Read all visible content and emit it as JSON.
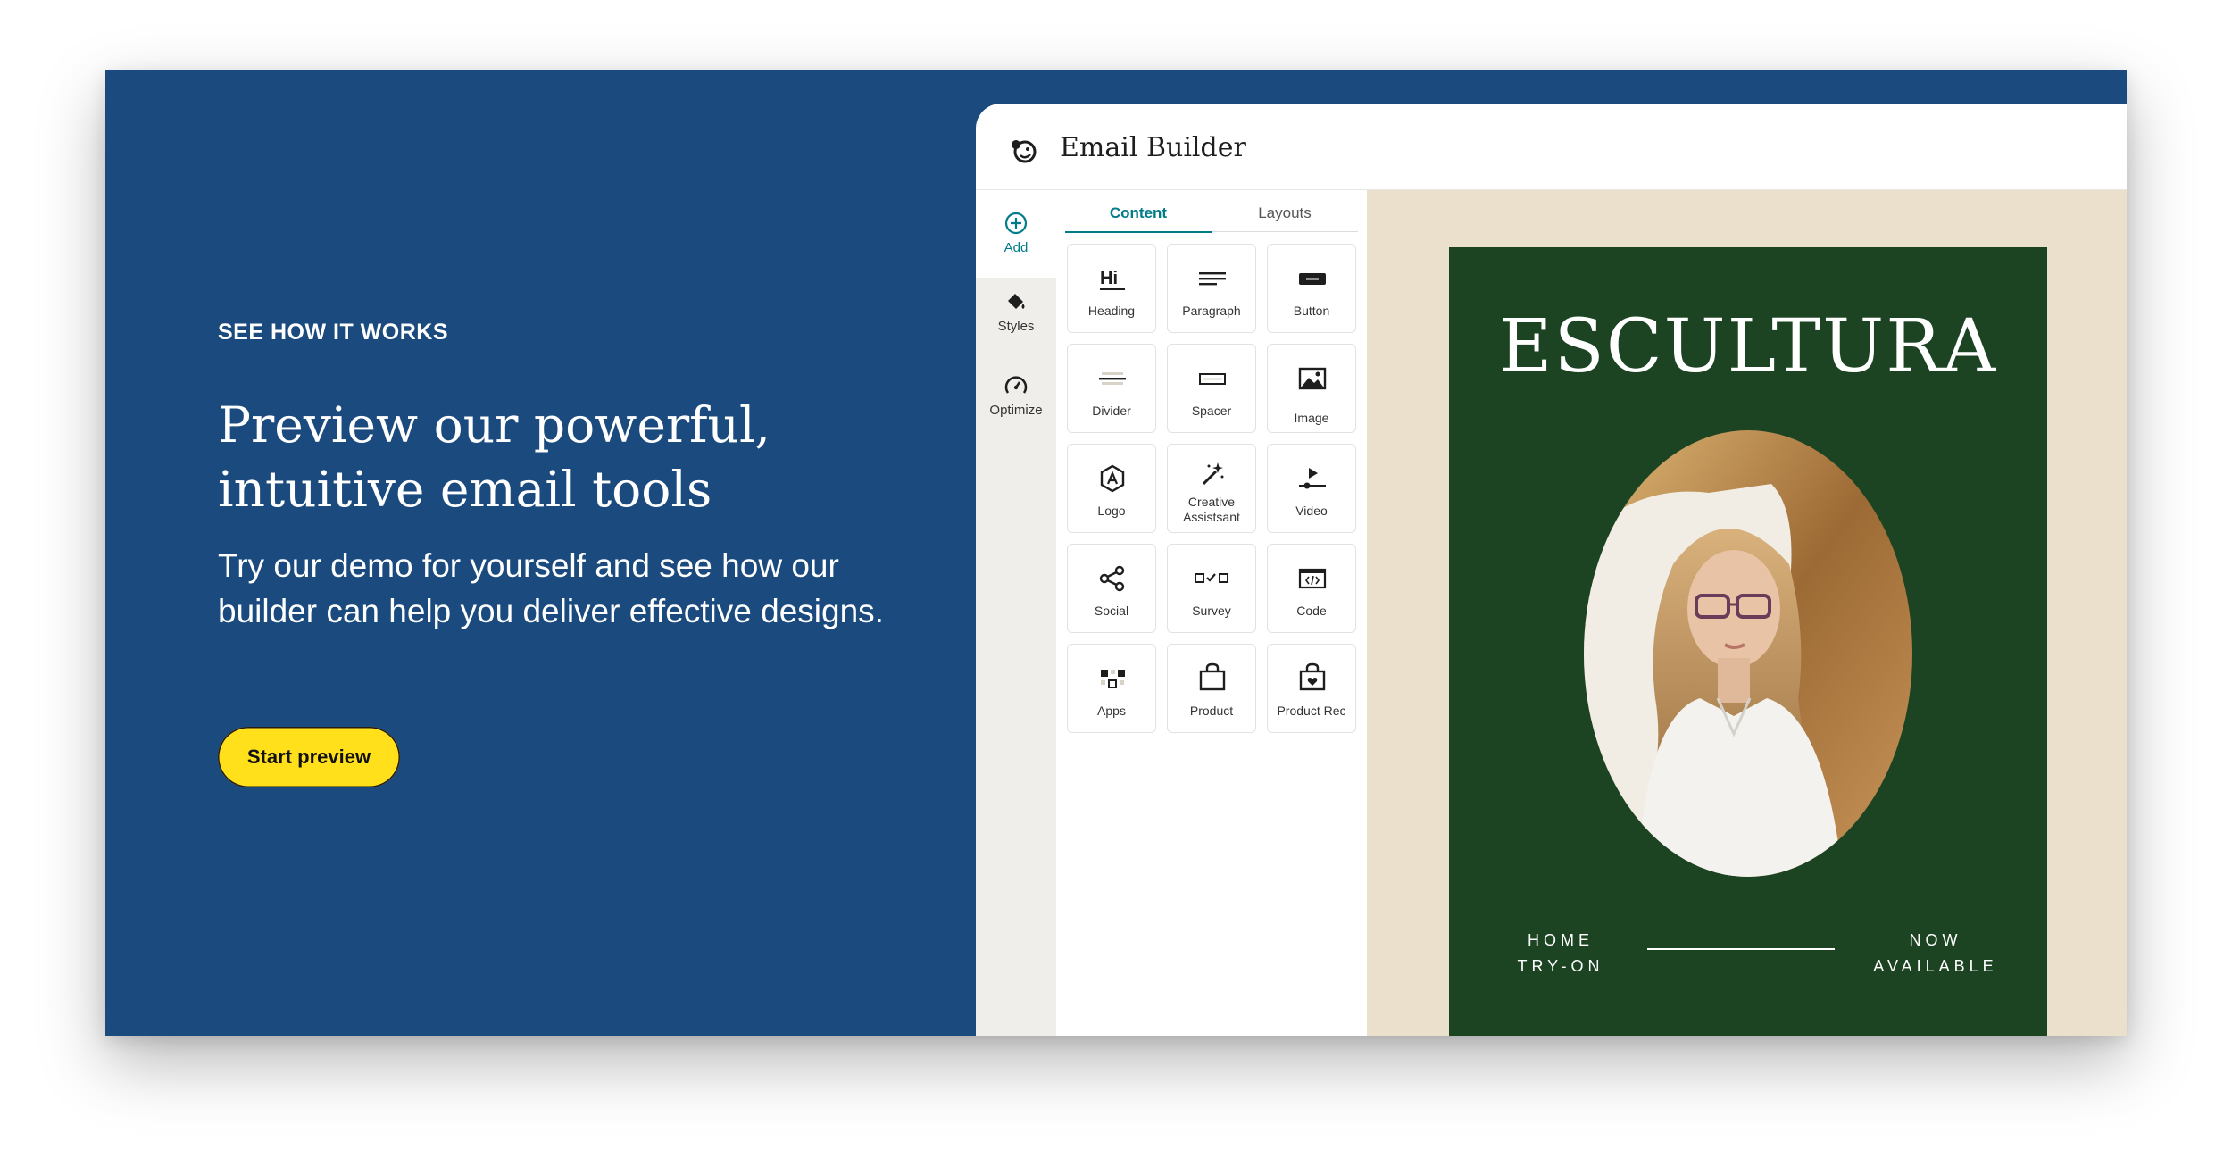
{
  "hero": {
    "eyebrow": "SEE HOW IT WORKS",
    "headline_line1": "Preview our powerful,",
    "headline_line2": "intuitive email tools",
    "subtext": "Try our demo for yourself and see how our builder can help you deliver effective designs.",
    "cta_label": "Start preview"
  },
  "builder": {
    "title": "Email Builder",
    "rail": [
      {
        "label": "Add",
        "icon": "plus-circle-icon"
      },
      {
        "label": "Styles",
        "icon": "paint-bucket-icon"
      },
      {
        "label": "Optimize",
        "icon": "gauge-icon"
      }
    ],
    "tabs": [
      {
        "label": "Content",
        "active": true
      },
      {
        "label": "Layouts",
        "active": false
      }
    ],
    "blocks": [
      {
        "label": "Heading",
        "icon": "heading-icon"
      },
      {
        "label": "Paragraph",
        "icon": "paragraph-icon"
      },
      {
        "label": "Button",
        "icon": "button-icon"
      },
      {
        "label": "Divider",
        "icon": "divider-icon"
      },
      {
        "label": "Spacer",
        "icon": "spacer-icon"
      },
      {
        "label": "Image",
        "icon": "image-icon"
      },
      {
        "label": "Logo",
        "icon": "logo-icon"
      },
      {
        "label": "Creative Assistant",
        "label_line1": "Creative",
        "label_line2": "Assistsant",
        "icon": "magic-wand-icon"
      },
      {
        "label": "Video",
        "icon": "video-icon"
      },
      {
        "label": "Social",
        "icon": "share-icon"
      },
      {
        "label": "Survey",
        "icon": "survey-icon"
      },
      {
        "label": "Code",
        "icon": "code-icon"
      },
      {
        "label": "Apps",
        "icon": "apps-icon"
      },
      {
        "label": "Product",
        "icon": "shopping-bag-icon"
      },
      {
        "label": "Product Rec",
        "icon": "product-rec-icon"
      }
    ],
    "heading_icon_text": "Hi"
  },
  "email_preview": {
    "brand": "ESCULTURA",
    "left_line1": "HOME",
    "left_line2": "TRY-ON",
    "right_line1": "NOW",
    "right_line2": "AVAILABLE"
  },
  "colors": {
    "hero_bg": "#1a4a7e",
    "cta_bg": "#ffe01b",
    "accent_teal": "#007c89",
    "canvas_bg": "#ebe0cc",
    "email_bg": "#1c4423"
  }
}
